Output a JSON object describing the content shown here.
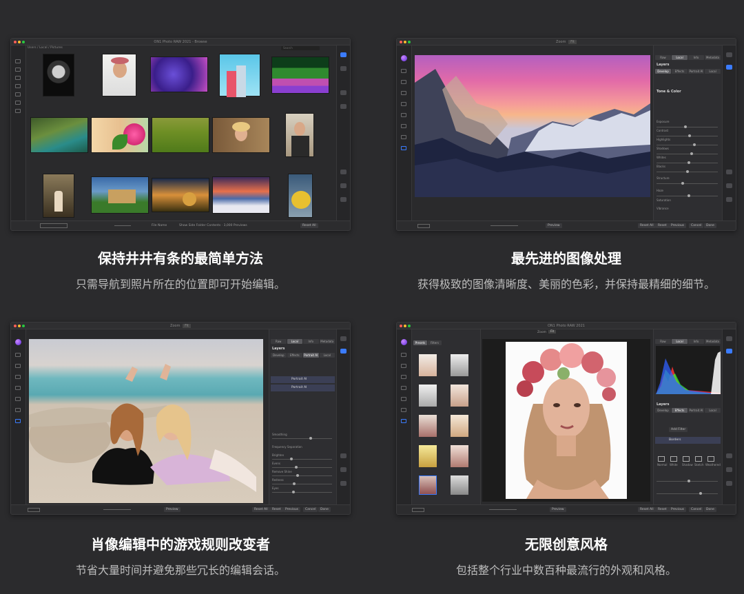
{
  "panels": [
    {
      "app_title": "ON1 Photo RAW 2021 - Browse",
      "title": "保持井井有条的最简单方法",
      "subtitle": "只需导航到照片所在的位置即可开始编辑。",
      "browse": {
        "breadcrumb": "Users / Local / Pictures",
        "search_placeholder": "Search",
        "modes": [
          "Browse",
          "Edit",
          "Layers"
        ],
        "sort_label": "File Name",
        "status": "Show Side Folder Contents · 3,000 Previews",
        "buttons": [
          "Reset All"
        ]
      }
    },
    {
      "title": "最先进的图像处理",
      "subtitle": "获得极致的图像清晰度、美丽的色彩，并保持最精细的细节。",
      "zoom_label": "Zoom",
      "zoom_value": "Fit",
      "tabs": [
        "Raw",
        "Local",
        "Info",
        "Metadata"
      ],
      "layers_title": "Layers",
      "sub_tabs": [
        "Develop",
        "Effects",
        "Portrait AI",
        "Local"
      ],
      "section": "Tone & Color",
      "sliders": [
        "Exposure",
        "Contrast",
        "Highlights",
        "Shadows",
        "Whites",
        "Blacks",
        "Structure",
        "Haze",
        "Saturation",
        "Vibrance"
      ],
      "buttons": [
        "Reset All",
        "Reset",
        "Previous",
        "Cancel",
        "Done"
      ],
      "preview_label": "Preview"
    },
    {
      "title": "肖像编辑中的游戏规则改变者",
      "subtitle": "节省大量时间并避免那些冗长的编辑会话。",
      "zoom_label": "Zoom",
      "zoom_value": "Fit",
      "tabs": [
        "Raw",
        "Local",
        "Info",
        "Metadata"
      ],
      "layers_title": "Layers",
      "sub_tabs": [
        "Develop",
        "Effects",
        "Portrait AI",
        "Local"
      ],
      "layers": [
        "Portrait AI",
        "Portrait AI"
      ],
      "sliders": [
        "Smoothing",
        "Frequency Separation",
        "Brighten",
        "Evens",
        "Remove Shine",
        "Redness",
        "Eyes"
      ],
      "buttons": [
        "Reset All",
        "Reset",
        "Previous",
        "Cancel",
        "Done"
      ],
      "preview_label": "Preview"
    },
    {
      "app_title": "ON1 Photo RAW 2021",
      "title": "无限创意风格",
      "subtitle": "包括整个行业中数百种最流行的外观和风格。",
      "zoom_label": "Zoom",
      "zoom_value": "Fit",
      "preset_tabs": [
        "Presets",
        "Filters"
      ],
      "tabs": [
        "Raw",
        "Local",
        "Info",
        "Metadata"
      ],
      "layers_title": "Layers",
      "sub_tabs": [
        "Develop",
        "Effects",
        "Portrait AI",
        "Local"
      ],
      "filter_section": "Borders",
      "add_filter": "Add Filter",
      "border_options": [
        "Normal",
        "White",
        "Shadow",
        "Sketch",
        "Weathered"
      ],
      "buttons": [
        "Reset All",
        "Reset",
        "Previous",
        "Cancel",
        "Done"
      ],
      "preview_label": "Preview"
    }
  ],
  "colors": {
    "background": "#2b2b2d",
    "accent": "#3b7cff"
  }
}
